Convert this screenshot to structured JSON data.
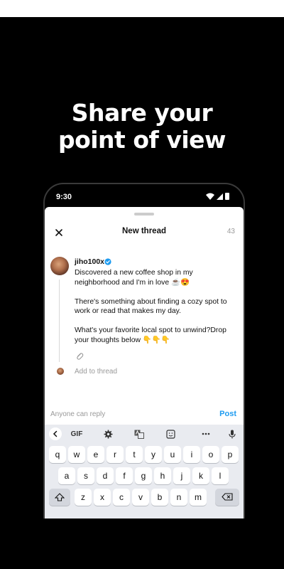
{
  "promo": {
    "headline_line1": "Share your",
    "headline_line2": "point of view"
  },
  "status_bar": {
    "time": "9:30"
  },
  "compose": {
    "title": "New thread",
    "char_count": "43",
    "username": "jiho100x",
    "post_paragraphs": [
      "Discovered a new coffee shop in my neighborhood and I'm in love ☕😍",
      "There's something about finding a cozy spot to work or read that makes my day.",
      "What's your favorite local spot to unwind?Drop your thoughts below 👇👇👇"
    ],
    "add_to_thread": "Add to thread",
    "audience": "Anyone can reply",
    "post_label": "Post"
  },
  "keyboard": {
    "toolbar": [
      "back-icon",
      "GIF",
      "settings-icon",
      "translate-icon",
      "sticker-icon",
      "more-icon",
      "mic-icon"
    ],
    "gif_label": "GIF",
    "row1": [
      "q",
      "w",
      "e",
      "r",
      "t",
      "y",
      "u",
      "i",
      "o",
      "p"
    ],
    "row2": [
      "a",
      "s",
      "d",
      "f",
      "g",
      "h",
      "j",
      "k",
      "l"
    ],
    "row3": [
      "z",
      "x",
      "c",
      "v",
      "b",
      "n",
      "m"
    ]
  },
  "colors": {
    "accent": "#1d9bf0",
    "background": "#000000",
    "keyboard": "#e9ebf0"
  }
}
